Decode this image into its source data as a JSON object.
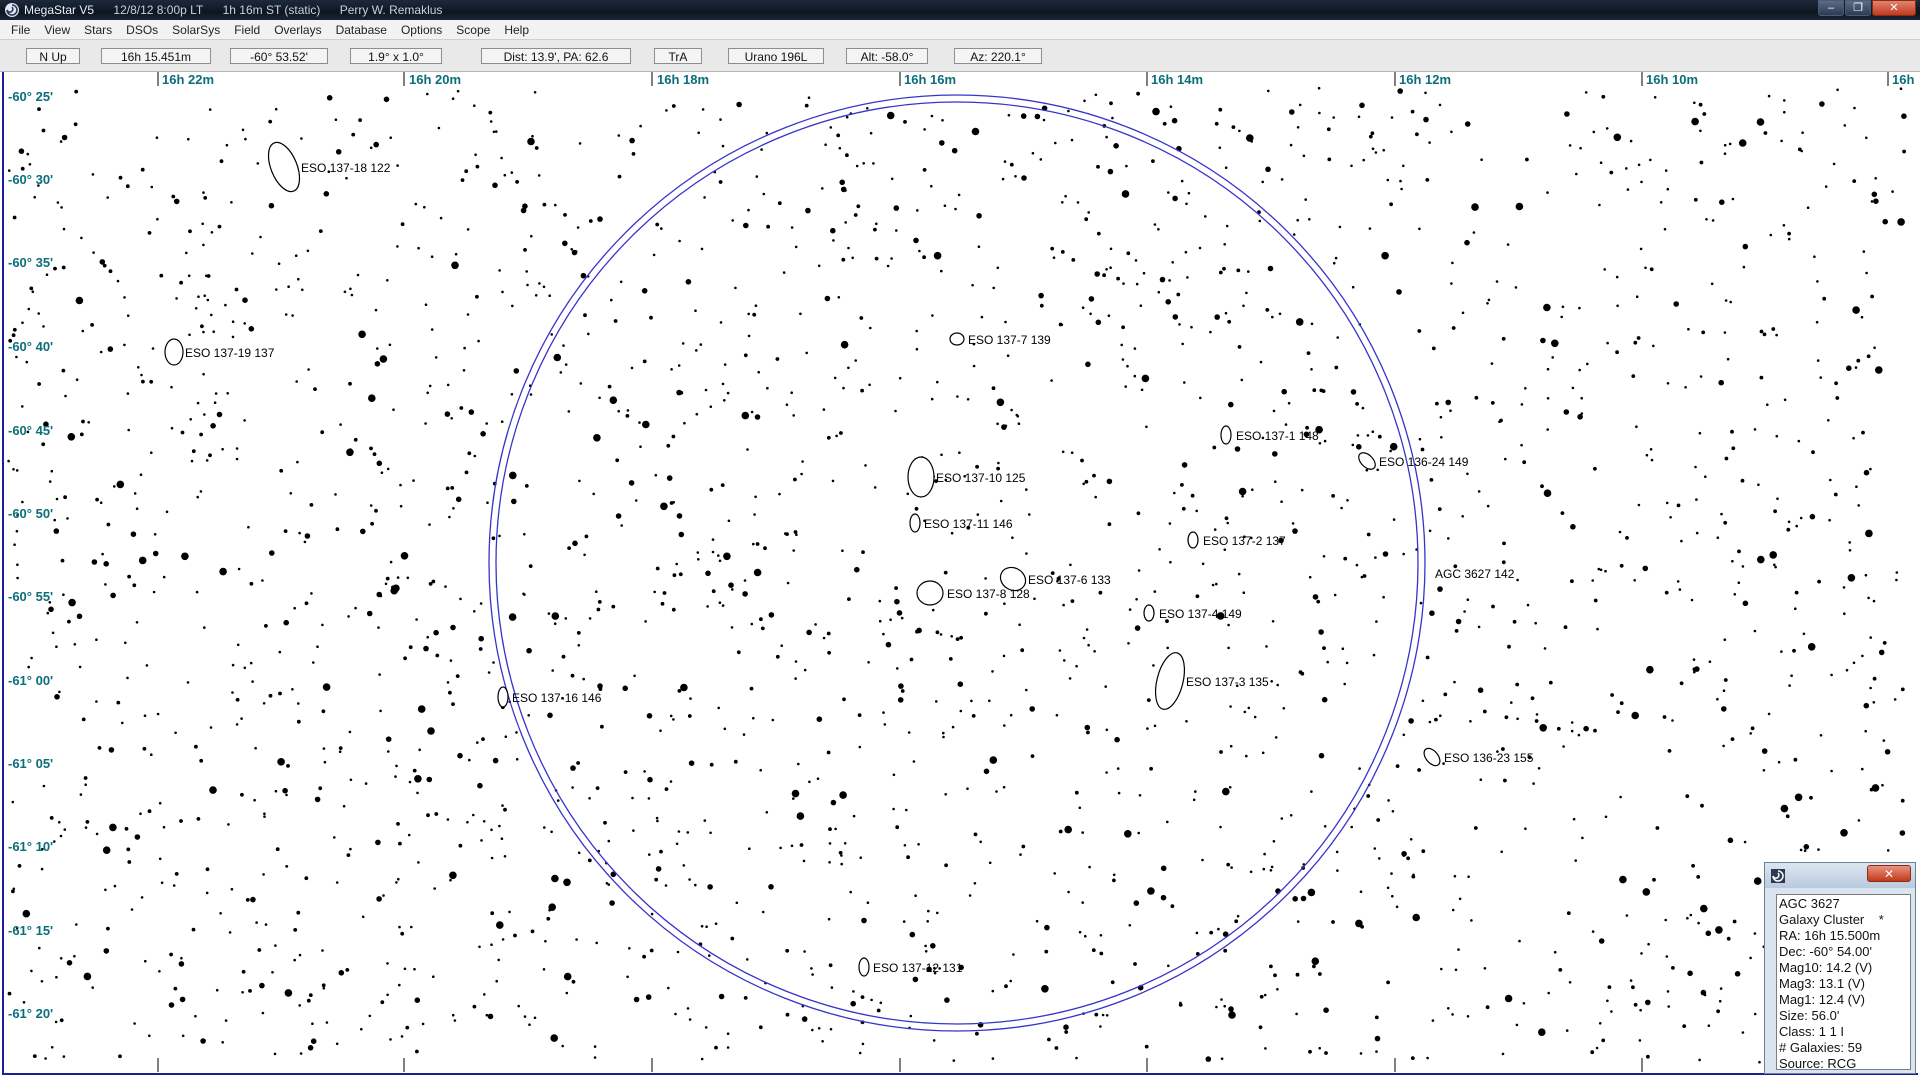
{
  "window": {
    "app_name": "MegaStar V5",
    "date_time": "12/8/12  8:00p LT",
    "sidereal": "1h 16m ST  (static)",
    "user": "Perry W. Remaklus",
    "controls": {
      "minimize": "–",
      "restore": "❐",
      "close": "✕"
    }
  },
  "menu": [
    "File",
    "View",
    "Stars",
    "DSOs",
    "SolarSys",
    "Field",
    "Overlays",
    "Database",
    "Options",
    "Scope",
    "Help"
  ],
  "status": {
    "orientation": "N Up",
    "ra": "16h 15.451m",
    "dec": "-60° 53.52'",
    "fov": "1.9° x 1.0°",
    "dist_pa": "Dist: 13.9', PA: 62.6",
    "constellation": "TrA",
    "atlas": "Urano 196L",
    "alt": "Alt: -58.0°",
    "az": "Az: 220.1°"
  },
  "chart": {
    "ra_ticks": [
      "16h 22m",
      "16h 20m",
      "16h 18m",
      "16h 16m",
      "16h 14m",
      "16h 12m",
      "16h 10m",
      "16h"
    ],
    "dec_ticks": [
      "-60° 25'",
      "-60° 30'",
      "-60° 35'",
      "-60° 40'",
      "-60° 45'",
      "-60° 50'",
      "-60° 55'",
      "-61° 00'",
      "-61° 05'",
      "-61° 10'",
      "-61° 15'",
      "-61° 20'"
    ],
    "colors": {
      "grid_label": "#0b6e7a",
      "circle": "#3535c8",
      "frame": "#1c1c9c"
    },
    "labels": [
      "ESO 137-18 122",
      "ESO 137-19 137",
      "ESO 137-7 139",
      "ESO 137-1 148",
      "ESO 136-24 149",
      "ESO 137-10 125",
      "ESO 137-11 146",
      "ESO 137-2 137",
      "AGC 3627 142",
      "ESO 137-6 133",
      "ESO 137-8 128",
      "ESO 137-4 149",
      "ESO 137-3 135",
      "ESO 137-16 146",
      "ESO 136-23 155",
      "ESO 137-12 131"
    ]
  },
  "info": {
    "close": "✕",
    "lines": [
      "AGC 3627",
      "Galaxy Cluster    *",
      "RA: 16h 15.500m",
      "Dec: -60° 54.00'",
      "Mag10: 14.2 (V)",
      "Mag3: 13.1 (V)",
      "Mag1: 12.4 (V)",
      "Size: 56.0'",
      "Class: 1 1 I",
      "# Galaxies: 59",
      "Source: RCG"
    ]
  }
}
